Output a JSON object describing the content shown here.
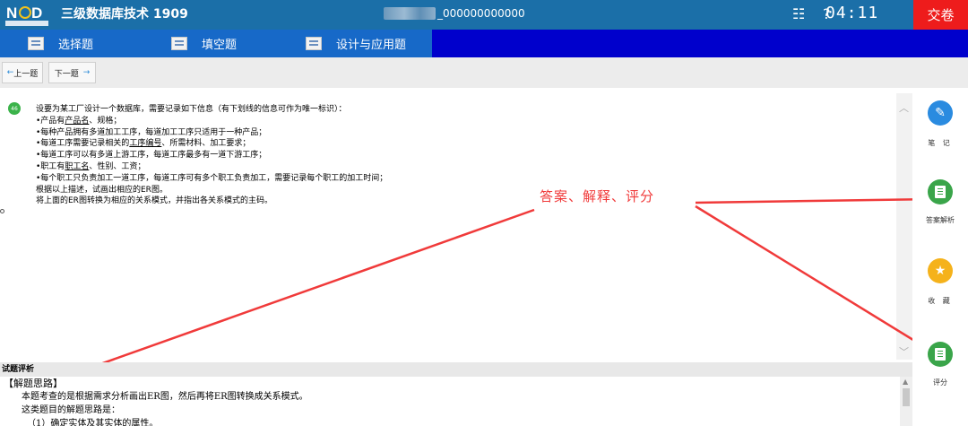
{
  "header": {
    "app_title": "三级数据库技术 1909",
    "candidate_id": "_000000000000",
    "list_icon": "list-icon",
    "help_icon": "?",
    "timer": "04:11",
    "submit_label": "交卷",
    "colors": {
      "titlebar": "#1b6fa8",
      "submit": "#ee1c1c"
    }
  },
  "tabs": [
    {
      "label": "选择题",
      "icon": "choice-icon"
    },
    {
      "label": "填空题",
      "icon": "fill-blank-icon"
    },
    {
      "label": "设计与应用题",
      "icon": "design-icon"
    }
  ],
  "nav": {
    "prev_label": "上一题",
    "next_label": "下一题"
  },
  "question": {
    "lines": [
      "设要为某工厂设计一个数据库，需要记录如下信息（有下划线的信息可作为唯一标识）：",
      "•每种产品拥有多道加工工序，每道加工工序只适用于一种产品；",
      "•每道工序可以有多道上游工序，每道工序最多有一道下游工序；",
      "•每个职工只负责加工一道工序，每道工序可有多个职工负责加工，需要记录每个职工的加工时间；",
      "根据以上描述，试画出相应的ER图。",
      "将上面的ER图转换为相应的关系模式，并指出各关系模式的主码。"
    ],
    "line_product": {
      "prefix": "•产品有",
      "underlined": "产品名",
      "suffix": "、规格；"
    },
    "line_process": {
      "prefix": "•每道工序需要记录相关的",
      "underlined": "工序编号",
      "suffix": "、所需材料、加工要求；"
    },
    "line_worker": {
      "prefix": "•职工有",
      "underlined": "职工名",
      "suffix": "、性别、工资；"
    }
  },
  "annotation": "答案、解释、评分",
  "analysis": {
    "header": "试题评析",
    "lines": [
      "【解题思路】",
      "本题考查的是根据需求分析画出ER图，然后再将ER图转换成关系模式。",
      "这类题目的解题思路是：",
      "（1）确定实体及其实体的属性。"
    ]
  },
  "sidebar": [
    {
      "label": "笔 记",
      "icon": "pencil-icon"
    },
    {
      "label": "答案解析",
      "icon": "answer-doc-icon"
    },
    {
      "label": "收 藏",
      "icon": "star-icon"
    },
    {
      "label": "评分",
      "icon": "score-doc-icon"
    }
  ]
}
